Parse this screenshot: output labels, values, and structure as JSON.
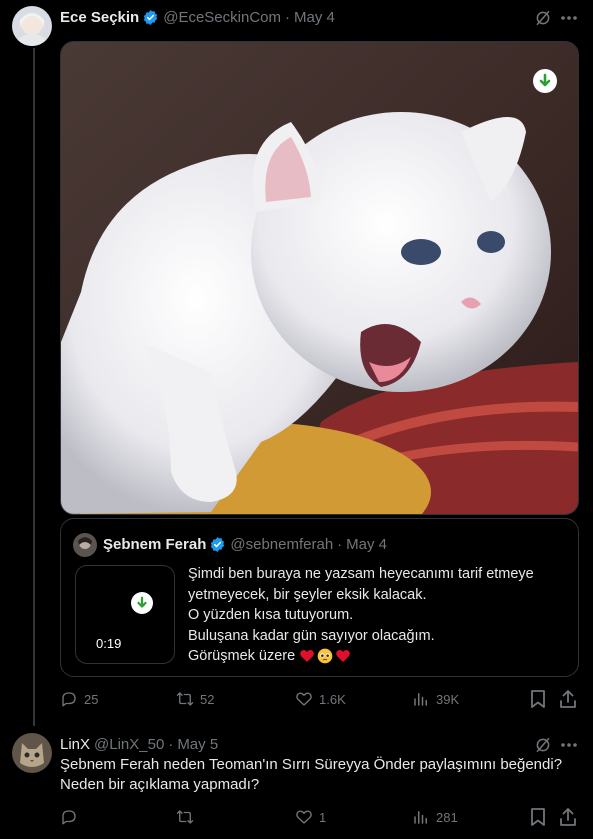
{
  "tweet1": {
    "author_name": "Ece Seçkin",
    "handle": "@EceSeckinCom",
    "date": "May 4",
    "media": {
      "type": "image",
      "subject": "white-kitten-crying-meme"
    },
    "quote": {
      "author_name": "Şebnem Ferah",
      "handle": "@sebnemferah",
      "date": "May 4",
      "video_duration": "0:19",
      "lines": [
        "Şimdi ben buraya ne yazsam heyecanımı tarif etmeye",
        "yetmeyecek, bir şeyler eksik kalacak.",
        "O yüzden kısa tutuyorum.",
        "Buluşana kadar gün sayıyor olacağım.",
        "Görüşmek üzere"
      ],
      "emojis": [
        "red-heart-emoji",
        "pleading-face-emoji",
        "red-heart-emoji"
      ]
    },
    "actions": {
      "replies": "25",
      "retweets": "52",
      "likes": "1.6K",
      "views": "39K"
    }
  },
  "tweet2": {
    "author_name": "LinX",
    "handle": "@LinX_50",
    "date": "May 5",
    "lines": [
      "Şebnem Ferah neden Teoman'ın Sırrı Süreyya Önder paylaşımını beğendi?",
      "Neden bir açıklama yapmadı?"
    ],
    "actions": {
      "replies": "",
      "retweets": "",
      "likes": "1",
      "views": "281"
    }
  },
  "colors": {
    "background": "#000000",
    "text": "#e7e9ea",
    "muted": "#71767b",
    "verified": "#1d9bf0",
    "download": "#2e9e36",
    "border": "#2f3336"
  }
}
